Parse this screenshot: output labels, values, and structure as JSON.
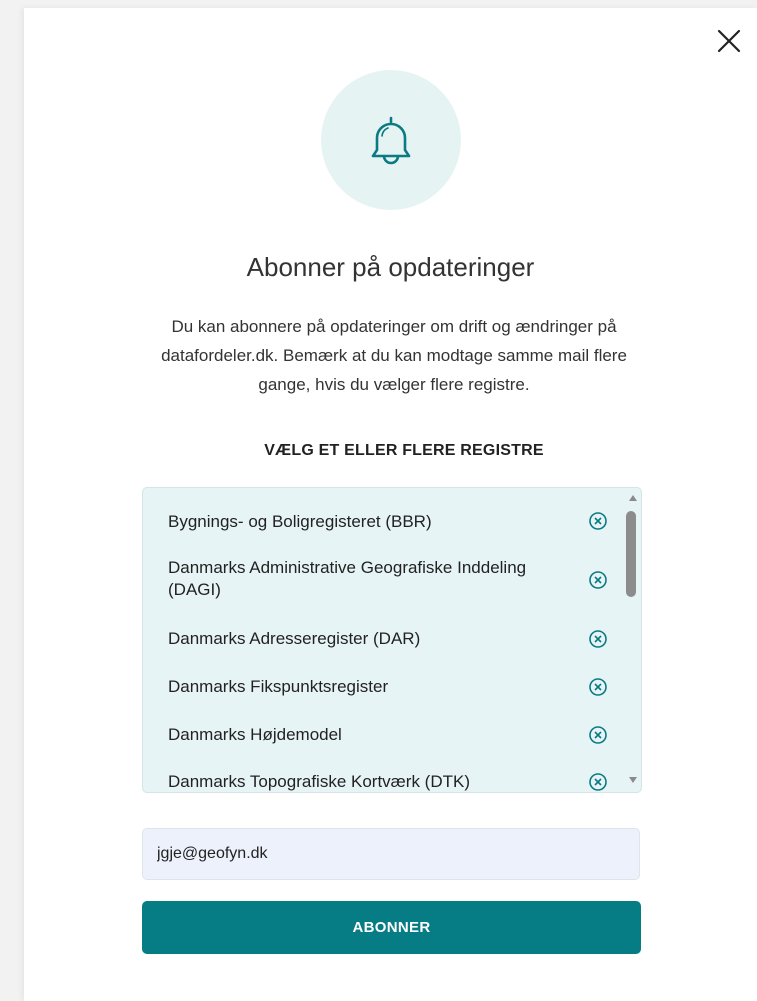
{
  "modal": {
    "title": "Abonner på opdateringer",
    "description": "Du kan abonnere på opdateringer om drift og ændringer på datafordeler.dk. Bemærk at du kan modtage samme mail flere gange, hvis du vælger flere registre.",
    "section_label": "VÆLG ET ELLER FLERE REGISTRE",
    "registers": [
      {
        "label": "Bygnings- og Boligregisteret (BBR)"
      },
      {
        "label": "Danmarks Administrative Geografiske Inddeling (DAGI)"
      },
      {
        "label": "Danmarks Adresseregister (DAR)"
      },
      {
        "label": "Danmarks Fikspunktsregister"
      },
      {
        "label": "Danmarks Højdemodel"
      },
      {
        "label": "Danmarks Topografiske Kortværk (DTK)"
      }
    ],
    "email": {
      "value": "jgje@geofyn.dk"
    },
    "submit_label": "ABONNER"
  },
  "colors": {
    "accent": "#067c85",
    "icon_circle_bg": "#e6f3f3",
    "list_bg": "#e7f4f6",
    "input_bg": "#edf1fb"
  },
  "icons": {
    "close": "close-icon",
    "bell": "bell-icon",
    "remove": "remove-circle-icon"
  }
}
